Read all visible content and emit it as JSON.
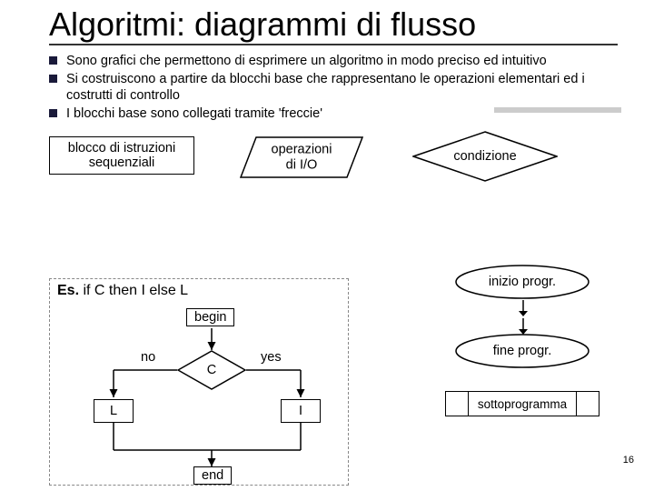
{
  "title": "Algoritmi: diagrammi di flusso",
  "bullets": [
    "Sono grafici che permettono di esprimere un algoritmo in modo preciso ed intuitivo",
    "Si costruiscono a partire da blocchi base che rappresentano le operazioni elementari ed i costrutti di controllo",
    "I blocchi base sono collegati tramite 'freccie'"
  ],
  "blocks": {
    "sequential": "blocco di istruzioni\nsequenziali",
    "io": "operazioni\ndi I/O",
    "condition": "condizione",
    "start": "inizio progr.",
    "end_prog": "fine progr.",
    "sub": "sottoprogramma"
  },
  "example": {
    "title_prefix": "Es.",
    "title_rest": " if C then I else L",
    "begin": "begin",
    "end": "end",
    "cond": "C",
    "no": "no",
    "yes": "yes",
    "I": "I",
    "L": "L"
  },
  "page": "16"
}
